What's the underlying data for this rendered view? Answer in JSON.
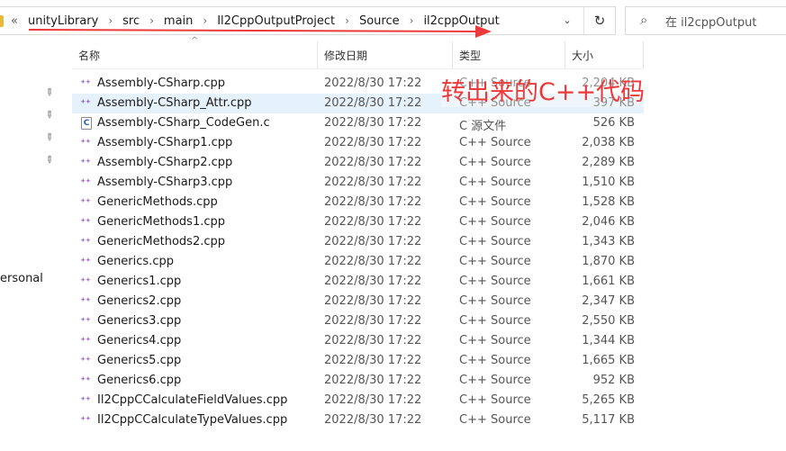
{
  "address_bar": {
    "overflow": "«",
    "crumbs": [
      "unityLibrary",
      "src",
      "main",
      "Il2CppOutputProject",
      "Source",
      "il2cppOutput"
    ],
    "separator": "›",
    "dropdown": "⌄",
    "refresh": "↻"
  },
  "search": {
    "icon": "⌕",
    "placeholder": "在 il2cppOutput"
  },
  "columns": {
    "name": "名称",
    "date": "修改日期",
    "type": "类型",
    "size": "大小"
  },
  "nav": {
    "partial_label": "ersonal"
  },
  "annotation": {
    "text": "转出来的C++代码",
    "color": "#ec3a3a"
  },
  "accent": {
    "selection": "#e5f1fb",
    "cpp_icon": "#7a3fb0"
  },
  "files": [
    {
      "icon": "cpp-icon",
      "glyph": "⁺⁺",
      "name": "Assembly-CSharp.cpp",
      "date": "2022/8/30 17:22",
      "type": "C++ Source",
      "size": "2,204 KB"
    },
    {
      "icon": "cpp-icon",
      "glyph": "⁺⁺",
      "name": "Assembly-CSharp_Attr.cpp",
      "date": "2022/8/30 17:22",
      "type": "C++ Source",
      "size": "397 KB",
      "selected": true
    },
    {
      "icon": "c-icon",
      "glyph": "C",
      "name": "Assembly-CSharp_CodeGen.c",
      "date": "2022/8/30 17:22",
      "type": "C 源文件",
      "size": "526 KB"
    },
    {
      "icon": "cpp-icon",
      "glyph": "⁺⁺",
      "name": "Assembly-CSharp1.cpp",
      "date": "2022/8/30 17:22",
      "type": "C++ Source",
      "size": "2,038 KB"
    },
    {
      "icon": "cpp-icon",
      "glyph": "⁺⁺",
      "name": "Assembly-CSharp2.cpp",
      "date": "2022/8/30 17:22",
      "type": "C++ Source",
      "size": "2,289 KB"
    },
    {
      "icon": "cpp-icon",
      "glyph": "⁺⁺",
      "name": "Assembly-CSharp3.cpp",
      "date": "2022/8/30 17:22",
      "type": "C++ Source",
      "size": "1,510 KB"
    },
    {
      "icon": "cpp-icon",
      "glyph": "⁺⁺",
      "name": "GenericMethods.cpp",
      "date": "2022/8/30 17:22",
      "type": "C++ Source",
      "size": "1,528 KB"
    },
    {
      "icon": "cpp-icon",
      "glyph": "⁺⁺",
      "name": "GenericMethods1.cpp",
      "date": "2022/8/30 17:22",
      "type": "C++ Source",
      "size": "2,046 KB"
    },
    {
      "icon": "cpp-icon",
      "glyph": "⁺⁺",
      "name": "GenericMethods2.cpp",
      "date": "2022/8/30 17:22",
      "type": "C++ Source",
      "size": "1,343 KB"
    },
    {
      "icon": "cpp-icon",
      "glyph": "⁺⁺",
      "name": "Generics.cpp",
      "date": "2022/8/30 17:22",
      "type": "C++ Source",
      "size": "1,870 KB"
    },
    {
      "icon": "cpp-icon",
      "glyph": "⁺⁺",
      "name": "Generics1.cpp",
      "date": "2022/8/30 17:22",
      "type": "C++ Source",
      "size": "1,661 KB"
    },
    {
      "icon": "cpp-icon",
      "glyph": "⁺⁺",
      "name": "Generics2.cpp",
      "date": "2022/8/30 17:22",
      "type": "C++ Source",
      "size": "2,347 KB"
    },
    {
      "icon": "cpp-icon",
      "glyph": "⁺⁺",
      "name": "Generics3.cpp",
      "date": "2022/8/30 17:22",
      "type": "C++ Source",
      "size": "2,550 KB"
    },
    {
      "icon": "cpp-icon",
      "glyph": "⁺⁺",
      "name": "Generics4.cpp",
      "date": "2022/8/30 17:22",
      "type": "C++ Source",
      "size": "1,344 KB"
    },
    {
      "icon": "cpp-icon",
      "glyph": "⁺⁺",
      "name": "Generics5.cpp",
      "date": "2022/8/30 17:22",
      "type": "C++ Source",
      "size": "1,665 KB"
    },
    {
      "icon": "cpp-icon",
      "glyph": "⁺⁺",
      "name": "Generics6.cpp",
      "date": "2022/8/30 17:22",
      "type": "C++ Source",
      "size": "952 KB"
    },
    {
      "icon": "cpp-icon",
      "glyph": "⁺⁺",
      "name": "Il2CppCCalculateFieldValues.cpp",
      "date": "2022/8/30 17:22",
      "type": "C++ Source",
      "size": "5,265 KB"
    },
    {
      "icon": "cpp-icon",
      "glyph": "⁺⁺",
      "name": "Il2CppCCalculateTypeValues.cpp",
      "date": "2022/8/30 17:22",
      "type": "C++ Source",
      "size": "5,117 KB"
    }
  ]
}
